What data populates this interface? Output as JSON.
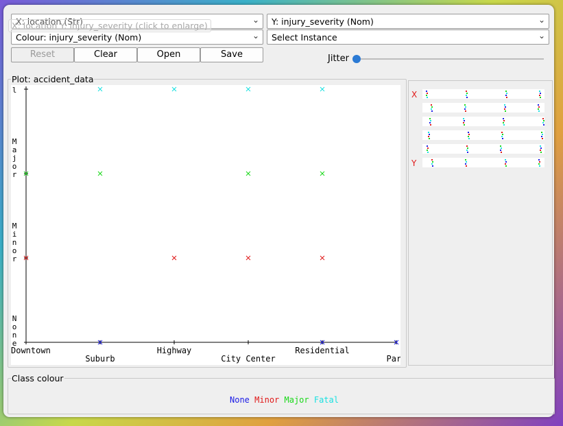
{
  "tooltip": "X: location Y: injury_severity (click to enlarge)",
  "controls": {
    "x_select": "X: location (Str)",
    "y_select": "Y: injury_severity (Nom)",
    "colour_select": "Colour: injury_severity (Nom)",
    "instance_select": "Select Instance",
    "reset": "Reset",
    "clear": "Clear",
    "open": "Open",
    "save": "Save",
    "jitter_label": "Jitter",
    "jitter_level": 0
  },
  "plot": {
    "title": "Plot: accident_data"
  },
  "colors": {
    "None": "#1a1ae6",
    "Minor": "#e01818",
    "Major": "#18d818",
    "Fatal": "#18e0e0"
  },
  "chart_data": {
    "type": "scatter",
    "x_categories": [
      "Downtown",
      "Suburb",
      "Highway",
      "City Center",
      "Residential",
      "Park"
    ],
    "y_categories": [
      "None",
      "Minor",
      "Major",
      "Fatal"
    ],
    "marker": "x",
    "points": [
      {
        "x": "Downtown",
        "y": "Minor",
        "colour": "Minor"
      },
      {
        "x": "Downtown",
        "y": "Major",
        "colour": "Major"
      },
      {
        "x": "Suburb",
        "y": "None",
        "colour": "None"
      },
      {
        "x": "Suburb",
        "y": "Major",
        "colour": "Major"
      },
      {
        "x": "Suburb",
        "y": "Fatal",
        "colour": "Fatal"
      },
      {
        "x": "Highway",
        "y": "Minor",
        "colour": "Minor"
      },
      {
        "x": "Highway",
        "y": "Fatal",
        "colour": "Fatal"
      },
      {
        "x": "City Center",
        "y": "Minor",
        "colour": "Minor"
      },
      {
        "x": "City Center",
        "y": "Major",
        "colour": "Major"
      },
      {
        "x": "City Center",
        "y": "Fatal",
        "colour": "Fatal"
      },
      {
        "x": "Residential",
        "y": "None",
        "colour": "None"
      },
      {
        "x": "Residential",
        "y": "Minor",
        "colour": "Minor"
      },
      {
        "x": "Residential",
        "y": "Major",
        "colour": "Major"
      },
      {
        "x": "Residential",
        "y": "Fatal",
        "colour": "Fatal"
      },
      {
        "x": "Park",
        "y": "None",
        "colour": "None"
      }
    ]
  },
  "attribute_panel": {
    "x_marker": "X",
    "y_marker": "Y"
  },
  "class_colour": {
    "title": "Class colour",
    "labels": [
      "None",
      "Minor",
      "Major",
      "Fatal"
    ]
  }
}
